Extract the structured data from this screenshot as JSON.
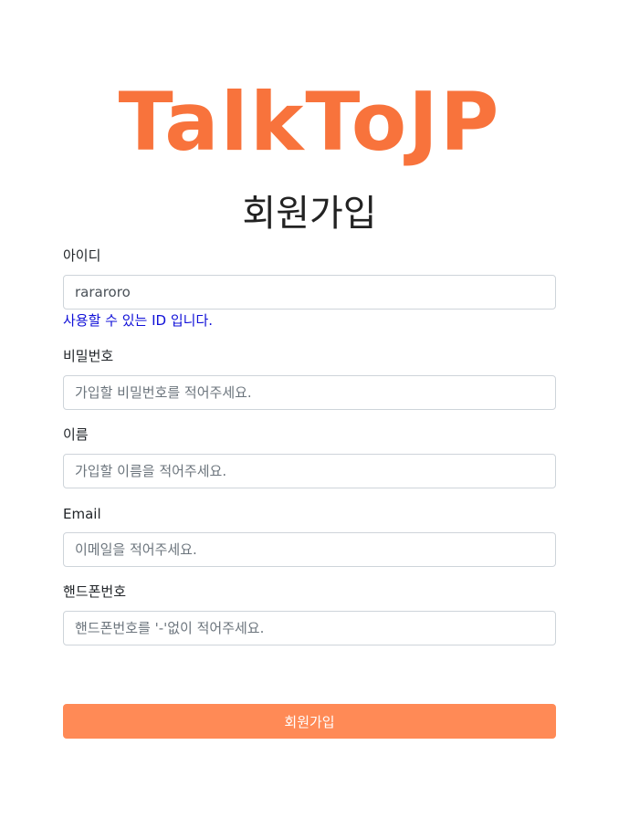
{
  "brand": {
    "logo_text": "TalkToJP"
  },
  "page": {
    "title": "회원가입"
  },
  "form": {
    "id": {
      "label": "아이디",
      "value": "rararoro",
      "placeholder": "",
      "help": "사용할 수 있는 ID 입니다."
    },
    "password": {
      "label": "비밀번호",
      "placeholder": "가입할 비밀번호를 적어주세요."
    },
    "name": {
      "label": "이름",
      "placeholder": "가입할 이름을 적어주세요."
    },
    "email": {
      "label": "Email",
      "placeholder": "이메일을 적어주세요."
    },
    "phone": {
      "label": "핸드폰번호",
      "placeholder": "핸드폰번호를 '-'없이 적어주세요."
    },
    "submit_label": "회원가입"
  },
  "colors": {
    "brand": "#f8733c",
    "button": "#ff8a56",
    "help_text": "#1010d8"
  }
}
